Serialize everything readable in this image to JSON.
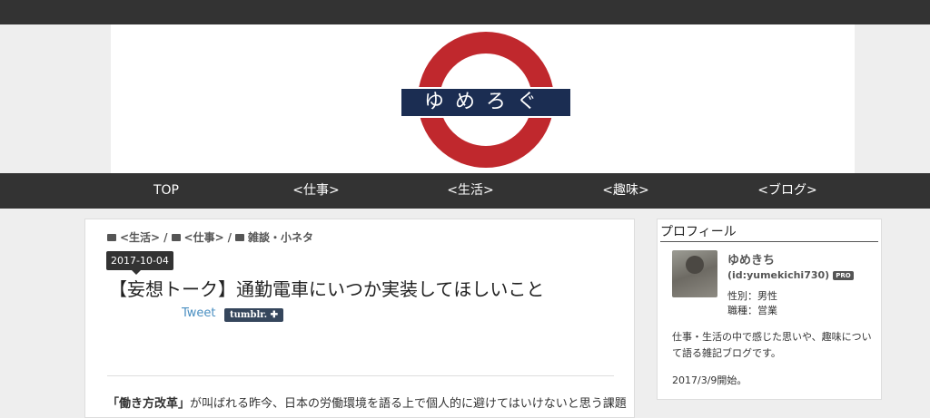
{
  "blog": {
    "logo_text": "ゆめろぐ"
  },
  "nav": {
    "items": [
      "TOP",
      "<仕事>",
      "<生活>",
      "<趣味>",
      "<ブログ>"
    ]
  },
  "article": {
    "breadcrumbs": [
      "<生活>",
      "<仕事>",
      "雑談・小ネタ"
    ],
    "date": "2017-10-04",
    "title": "【妄想トーク】通勤電車にいつか実装してほしいこと",
    "tweet_label": "Tweet",
    "tumblr_label": "tumblr.",
    "body_bold": "「働き方改革」",
    "body_text": "が叫ばれる昨今、日本の労働環境を語る上で個人的に避けてはいけないと思う課題"
  },
  "sidebar": {
    "title": "プロフィール",
    "name": "ゆめきち",
    "id": "(id:yumekichi730)",
    "pro": "PRO",
    "gender": "性別：男性",
    "job": "職種：営業",
    "description": "仕事・生活の中で感じた思いや、趣味について語る雑記ブログです。",
    "started": "2017/3/9開始。"
  },
  "colors": {
    "header_dark": "#333333",
    "logo_red": "#c0282d",
    "logo_navy": "#1b2d52",
    "link_blue": "#4a8fc1",
    "tumblr_bg": "#35465c"
  }
}
